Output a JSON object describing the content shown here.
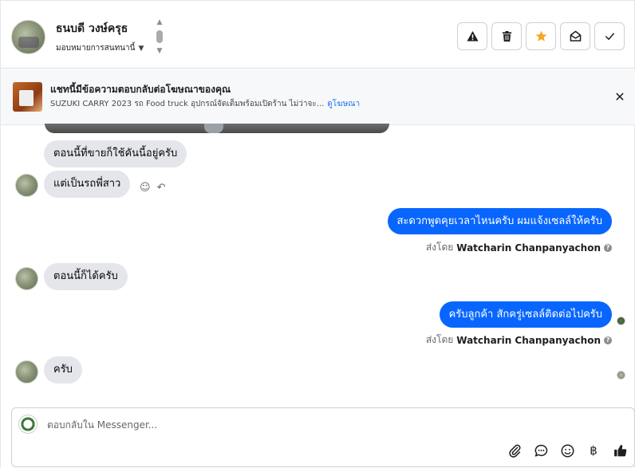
{
  "header": {
    "contact_name": "ธนบดี วงษ์ครุธ",
    "assign_label": "มอบหมายการสนทนานี้",
    "actions": [
      {
        "name": "warning",
        "icon": "warning-icon"
      },
      {
        "name": "delete",
        "icon": "trash-icon"
      },
      {
        "name": "star",
        "icon": "star-icon"
      },
      {
        "name": "mark-unread",
        "icon": "envelope-open-icon"
      },
      {
        "name": "done",
        "icon": "check-icon"
      }
    ]
  },
  "ad_banner": {
    "title": "แชทนี้มีข้อความตอบกลับต่อโฆษณาของคุณ",
    "subtitle": "SUZUKI CARRY 2023 รถ Food truck อุปกรณ์จัดเต็มพร้อมเปิดร้าน ไม่ว่าจะ...",
    "link": "ดูโฆษณา"
  },
  "messages": [
    {
      "id": "m1",
      "dir": "in",
      "text": "ตอนนี้ที่ขายก็ใช้คันนี้อยู่ครับ"
    },
    {
      "id": "m2",
      "dir": "in",
      "text": "แต่เป็นรถพี่สาว"
    },
    {
      "id": "m3",
      "dir": "out",
      "text": "สะดวกพูดคุยเวลาไหนครับ ผมแจ้งเซลล์ให้ครับ",
      "sent_by_prefix": "ส่งโดย",
      "sent_by": "Watcharin Chanpanyachon"
    },
    {
      "id": "m4",
      "dir": "in",
      "text": "ตอนนี้ก็ได้ครับ"
    },
    {
      "id": "m5",
      "dir": "out",
      "text": "ครับลูกค้า สักครู่เซลล์ติดต่อไปครับ",
      "sent_by_prefix": "ส่งโดย",
      "sent_by": "Watcharin Chanpanyachon"
    },
    {
      "id": "m6",
      "dir": "in",
      "text": "ครับ"
    }
  ],
  "composer": {
    "placeholder": "ตอบกลับใน Messenger...",
    "tools": [
      "paperclip-icon",
      "chat-bubble-icon",
      "emoji-icon",
      "baht-icon",
      "thumbs-up-icon"
    ]
  },
  "colors": {
    "outgoing_bubble": "#0866ff",
    "incoming_bubble": "#e4e6eb",
    "star": "#f5a623"
  }
}
